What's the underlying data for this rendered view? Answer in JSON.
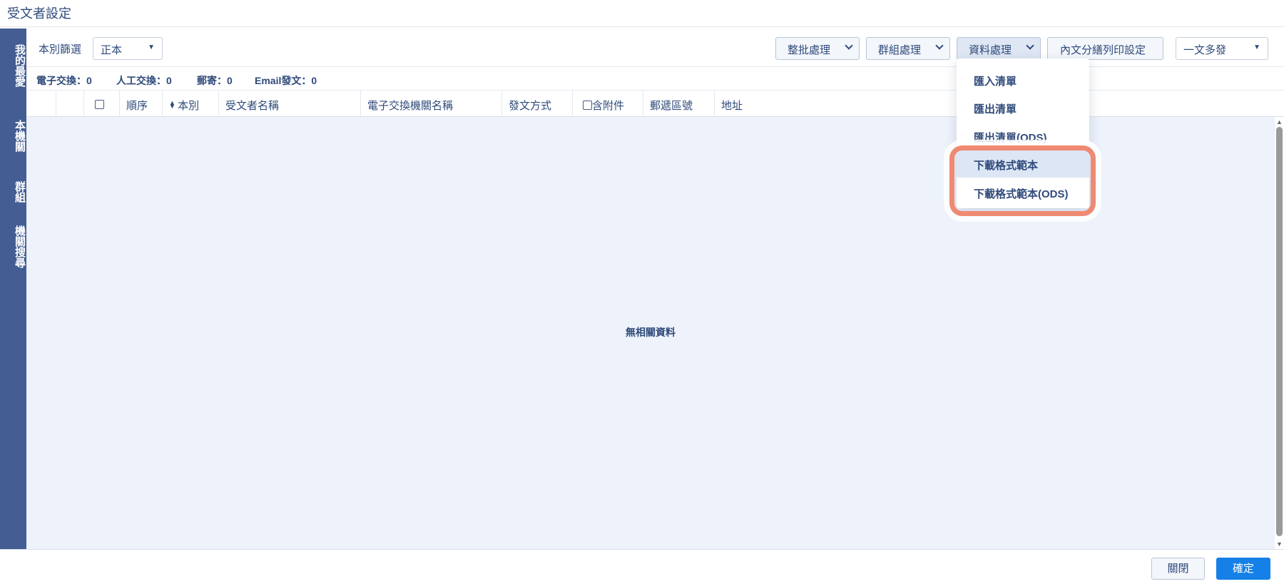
{
  "window": {
    "title": "受文者設定"
  },
  "left_rail": {
    "favorites": "我的最愛",
    "local": "本機關",
    "group": "群組",
    "search": "機關搜尋"
  },
  "toolbar": {
    "filter_label": "本別篩選",
    "filter_value": "正本",
    "batch_label": "整批處理",
    "group_label": "群組處理",
    "data_label": "資料處理",
    "print_label": "內文分繕列印設定",
    "multi_value": "一文多發"
  },
  "stats": {
    "electronic": "電子交換：0",
    "manual": "人工交換：0",
    "mail": "郵寄：0",
    "email": "Email發文：0"
  },
  "grid": {
    "columns": {
      "order": "順序",
      "type": "本別",
      "recipient": "受文者名稱",
      "agency": "電子交換機關名稱",
      "method": "發文方式",
      "attachment": "含附件",
      "zipcode": "郵遞區號",
      "address": "地址"
    },
    "empty_message": "無相關資料"
  },
  "data_menu": {
    "items": [
      "匯入清單",
      "匯出清單",
      "匯出清單(ODS)",
      "下載格式範本",
      "下載格式範本(ODS)"
    ],
    "highlighted": "下載格式範本"
  },
  "footer": {
    "close_label": "關閉",
    "ok_label": "確定"
  },
  "colors": {
    "rail": "#445e93",
    "accent": "#1480e8",
    "highlight_ring": "#ef8a72",
    "grid_bg": "#edf2fb"
  },
  "icons": {
    "caret": "caret-down-icon",
    "chevron": "chevron-down-icon",
    "sort": "sort-icon"
  }
}
